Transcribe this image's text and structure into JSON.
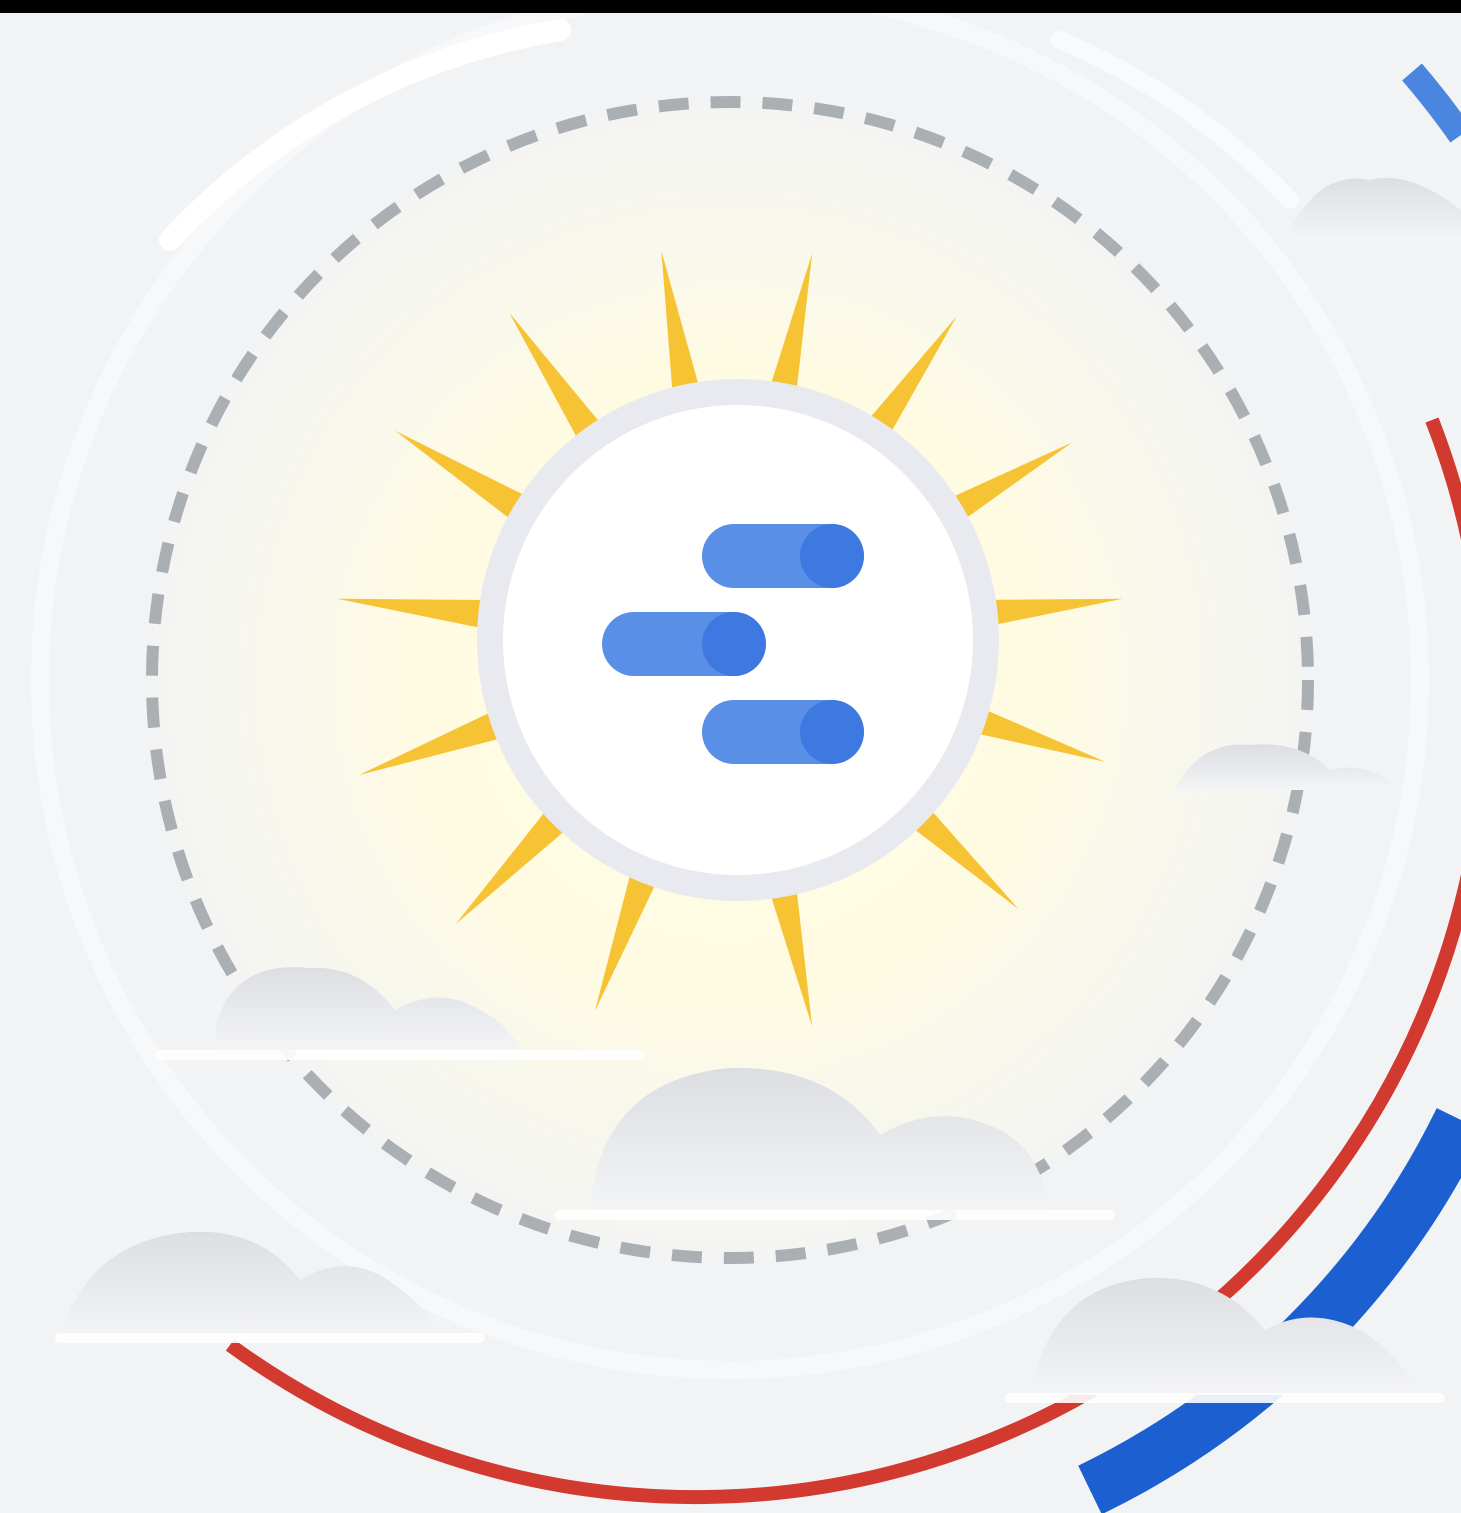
{
  "illustration": {
    "subject": "sun-with-bars-logo",
    "colors": {
      "background": "#f2f3f5",
      "top_bar": "#000000",
      "sun_ray": "#f6c335",
      "sun_glow": "#fffbe3",
      "dashed_ring": "#a9afb3",
      "inner_ring": "#e8eaef",
      "inner_disc": "#ffffff",
      "bar_light": "#5a8fe8",
      "bar_dark": "#3d79e0",
      "red_arc": "#d2392f",
      "blue_arc": "#1b5fd0",
      "blue_arc_top": "#4a86e0",
      "cloud": "#e3e5e8"
    },
    "icons": [
      "sun-icon",
      "bars-logo-icon",
      "cloud-icon"
    ]
  }
}
